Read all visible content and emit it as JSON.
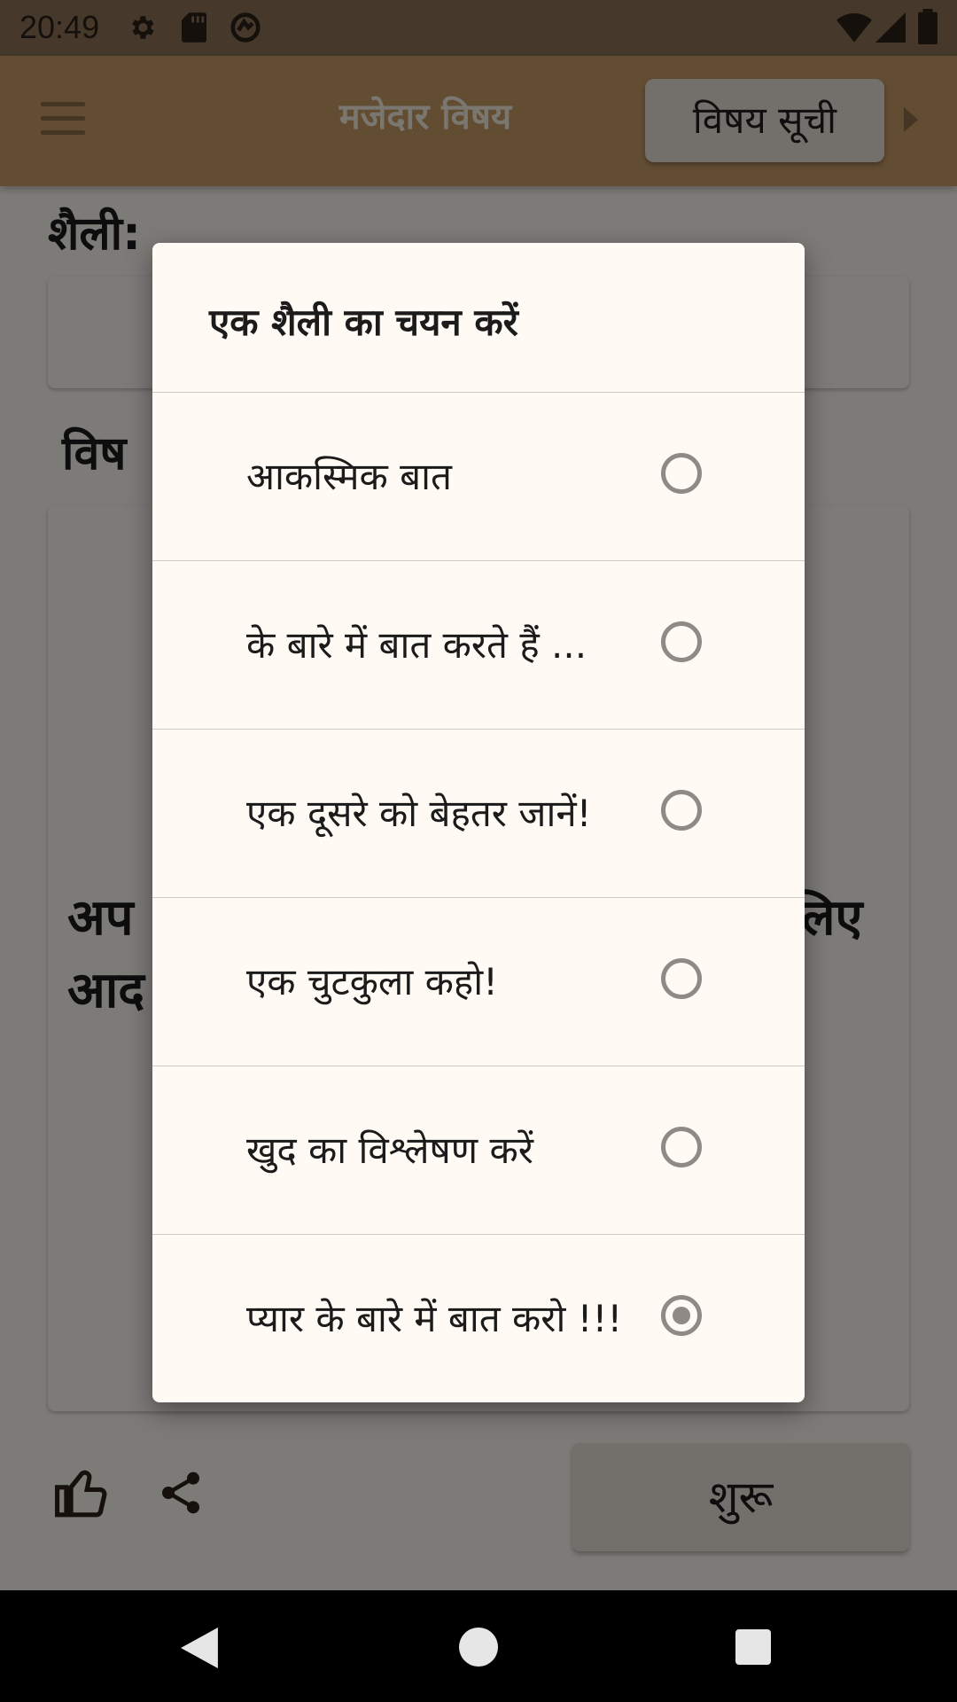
{
  "status_bar": {
    "time": "20:49",
    "icons": [
      "settings-icon",
      "sd-card-icon",
      "sync-icon",
      "wifi-icon",
      "signal-icon",
      "battery-icon"
    ]
  },
  "app_bar": {
    "menu_icon": "hamburger-menu-icon",
    "title": "मजेदार विषय",
    "topics_button": "विषय सूची",
    "arrow_icon": "triangle-right-icon"
  },
  "main": {
    "style_heading": "शैली:",
    "topic_heading_partial": "विष",
    "prompt_partial_left_line1": "अप",
    "prompt_partial_left_line2": "आद",
    "prompt_partial_right_line1": "लिए",
    "start_button": "शुरू",
    "like_icon": "thumbs-up-icon",
    "share_icon": "share-icon"
  },
  "dialog": {
    "title": "एक शैली का चयन करें",
    "options": [
      {
        "label": "आकस्मिक बात",
        "selected": false
      },
      {
        "label": "के बारे में बात करते हैं ...",
        "selected": false
      },
      {
        "label": "एक दूसरे को बेहतर जानें!",
        "selected": false
      },
      {
        "label": "एक चुटकुला कहो!",
        "selected": false
      },
      {
        "label": "खुद का विश्लेषण करें",
        "selected": false
      },
      {
        "label": "प्यार के बारे में बात करो !!!",
        "selected": true
      }
    ]
  },
  "nav_bar": {
    "back_icon": "back-triangle-icon",
    "home_icon": "home-circle-icon",
    "recents_icon": "recents-square-icon"
  },
  "colors": {
    "app_bar": "#C49A66",
    "background": "#FBF7F1",
    "dialog": "#FFFAF4",
    "radio": "#8E8A86"
  }
}
